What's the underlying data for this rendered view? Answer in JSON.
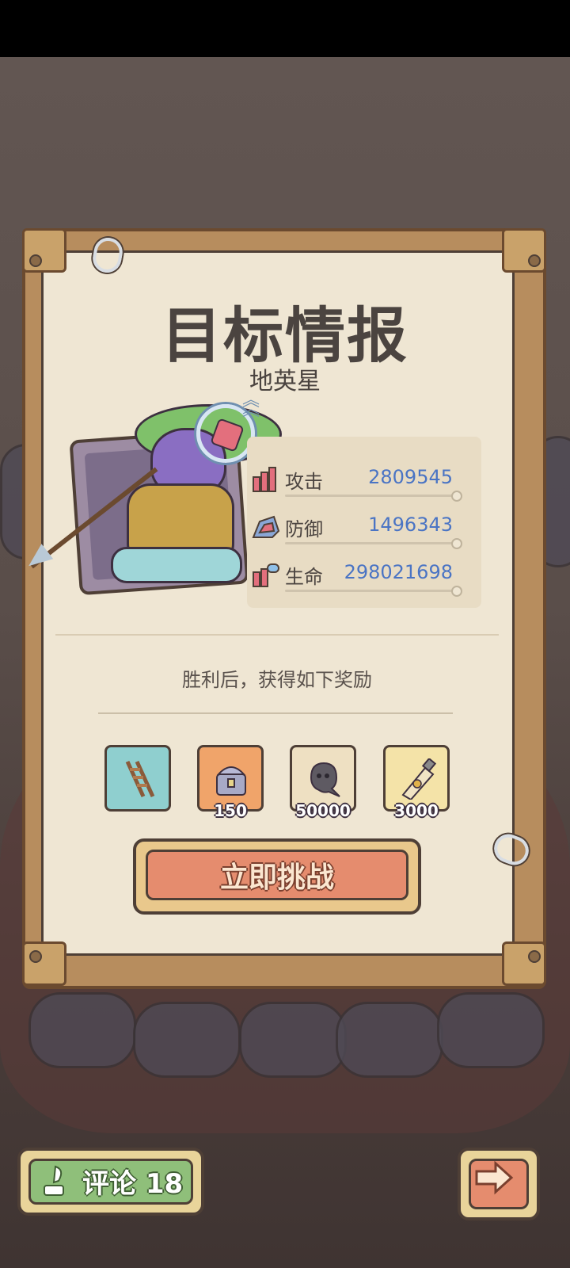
{
  "panel": {
    "title": "目标情报",
    "subtitle": "地英星"
  },
  "stats": [
    {
      "label": "攻击",
      "value": "2809545",
      "icon": "attack-icon"
    },
    {
      "label": "防御",
      "value": "1496343",
      "icon": "defense-icon"
    },
    {
      "label": "生命",
      "value": "298021698",
      "icon": "health-icon"
    }
  ],
  "rewards": {
    "caption": "胜利后，获得如下奖励",
    "items": [
      {
        "icon": "ladder-icon",
        "count": ""
      },
      {
        "icon": "treasure-chest-icon",
        "count": "150"
      },
      {
        "icon": "ghost-icon",
        "count": "50000"
      },
      {
        "icon": "tube-icon",
        "count": "3000"
      }
    ]
  },
  "buttons": {
    "challenge": "立即挑战",
    "comment": "评论 18"
  },
  "colors": {
    "value_blue": "#4a74c4",
    "challenge_button": "#e58c6e",
    "comment_button": "#8fbf7a"
  }
}
